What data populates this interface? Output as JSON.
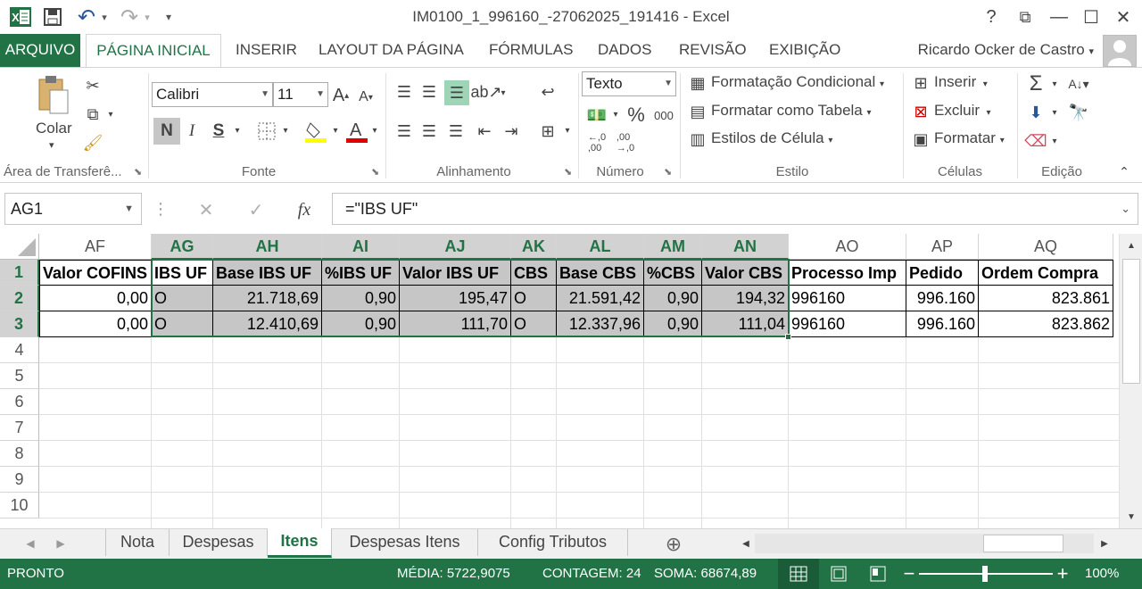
{
  "window": {
    "title": "IM0100_1_996160_-27062025_191416 - Excel",
    "help": "?",
    "restore_ribbon": "⧉",
    "minimize": "—",
    "maximize": "☐",
    "close": "✕"
  },
  "qat": {
    "undo": "↶",
    "redo": "↷",
    "customize": "▾"
  },
  "tabs": [
    "ARQUIVO",
    "PÁGINA INICIAL",
    "INSERIR",
    "LAYOUT DA PÁGINA",
    "FÓRMULAS",
    "DADOS",
    "REVISÃO",
    "EXIBIÇÃO"
  ],
  "user": "Ricardo Ocker de Castro",
  "ribbon": {
    "clipboard": {
      "paste": "Colar",
      "label": "Área de Transferê..."
    },
    "font": {
      "name": "Calibri",
      "size": "11",
      "bold": "N",
      "italic": "I",
      "underline": "S",
      "label": "Fonte"
    },
    "alignment": {
      "label": "Alinhamento"
    },
    "number": {
      "format": "Texto",
      "percent": "%",
      "thousands": "000",
      "label": "Número"
    },
    "styles": {
      "conditional": "Formatação Condicional",
      "as_table": "Formatar como Tabela",
      "cell_styles": "Estilos de Célula",
      "label": "Estilo"
    },
    "cells": {
      "insert": "Inserir",
      "delete": "Excluir",
      "format": "Formatar",
      "label": "Células"
    },
    "editing": {
      "label": "Edição"
    }
  },
  "formula_bar": {
    "name_box": "AG1",
    "fx": "fx",
    "formula": "=\"IBS UF\""
  },
  "grid": {
    "columns": [
      "AF",
      "AG",
      "AH",
      "AI",
      "AJ",
      "AK",
      "AL",
      "AM",
      "AN",
      "AO",
      "AP",
      "AQ"
    ],
    "rows": [
      "1",
      "2",
      "3",
      "4",
      "5",
      "6",
      "7",
      "8",
      "9",
      "10"
    ],
    "header_row": [
      "Valor COFINS",
      "IBS UF",
      "Base IBS UF",
      "%IBS UF",
      "Valor IBS UF",
      "CBS",
      "Base CBS",
      "%CBS",
      "Valor CBS",
      "Processo Imp",
      "Pedido",
      "Ordem Compra"
    ],
    "data_rows": [
      [
        "0,00",
        "O",
        "21.718,69",
        "0,90",
        "195,47",
        "O",
        "21.591,42",
        "0,90",
        "194,32",
        "996160",
        "996.160",
        "823.861"
      ],
      [
        "0,00",
        "O",
        "12.410,69",
        "0,90",
        "111,70",
        "O",
        "12.337,96",
        "0,90",
        "111,04",
        "996160",
        "996.160",
        "823.862"
      ]
    ]
  },
  "sheets": [
    "Nota",
    "Despesas",
    "Itens",
    "Despesas Itens",
    "Config Tributos"
  ],
  "active_sheet": "Itens",
  "status": {
    "mode": "PRONTO",
    "average": "MÉDIA: 5722,9075",
    "count": "CONTAGEM: 24",
    "sum": "SOMA: 68674,89",
    "zoom": "100%"
  },
  "colors": {
    "accent": "#217346",
    "selected_fill": "#c6c6c6"
  }
}
